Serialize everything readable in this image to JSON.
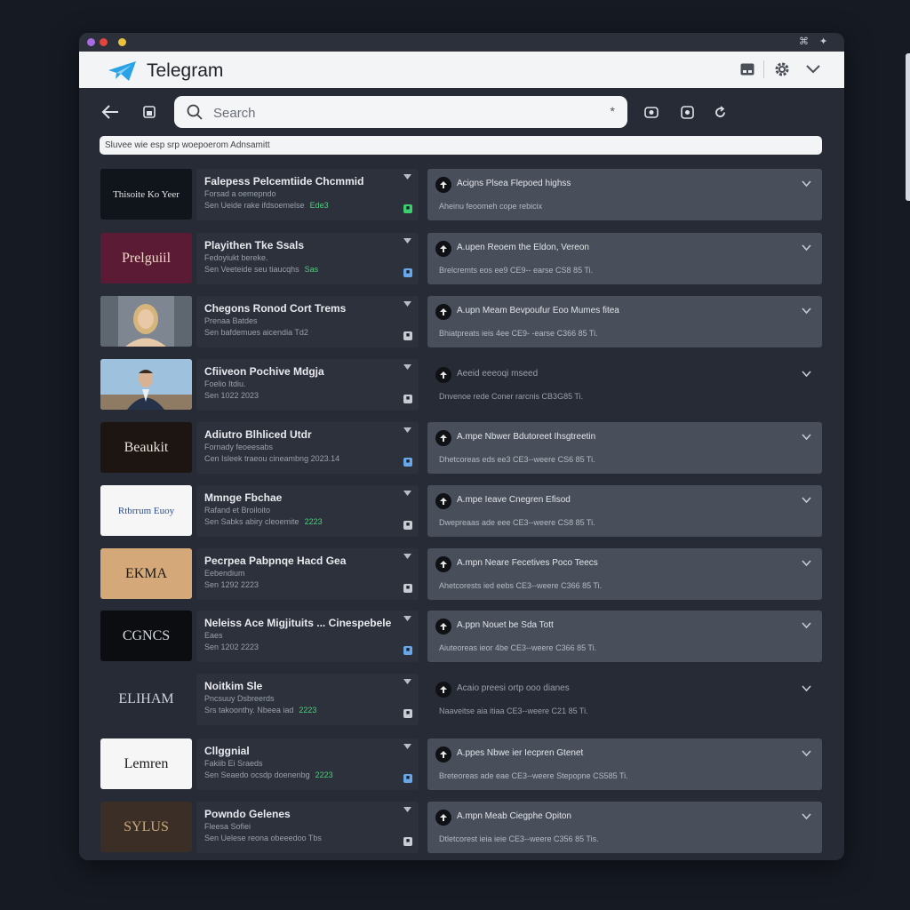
{
  "window": {
    "title_bar_icons": [
      "pin-icon",
      "expand-icon"
    ],
    "traffic_lights": [
      "#a86be0",
      "#e0453f",
      "#e8c23a"
    ]
  },
  "app": {
    "title": "Telegram",
    "accent": "#2aa3e6"
  },
  "toolbar": {
    "search_placeholder": "Search",
    "clear_symbol": "*"
  },
  "notice": "Sluvee wie esp srp woepoerom Adnsamitt",
  "rows": [
    {
      "thumb": {
        "text": "Thisoite Ko Yeer",
        "bg": "#10141b",
        "fg": "#e5e5e5"
      },
      "title": "Falepess Pelcemtiide Chcmmid",
      "subtitle": "Forsad a oemepndo",
      "meta": "Sen   Ueide rake ifdsoemelse",
      "tag": "Ede3",
      "badge_color": "#3ccf6e",
      "msg_head": "Acigns Plsea Flepoed highss",
      "msg_meta": "Aheinu feoomeh cope rebicix",
      "msg_style": "filled"
    },
    {
      "thumb": {
        "text": "Prelguiil",
        "bg": "#5b1b35",
        "fg": "#f0d7c7"
      },
      "title": "Playithen Tke Ssals",
      "subtitle": "Fedoyiukt bereke.",
      "meta": "Sen   Veeteide seu tiaucqhs",
      "tag": "Sas",
      "badge_color": "#6aa7e8",
      "msg_head": "A.upen Reoem the Eldon, Vereon",
      "msg_meta": "Brelcremts eos ee9   CE9-- earse   CS8 85 Ti.",
      "msg_style": "filled"
    },
    {
      "thumb": {
        "text": "",
        "bg": "#6b7580",
        "fg": "#ffffff",
        "photo": "woman"
      },
      "title": "Chegons Ronod Cort Trems",
      "subtitle": "Prenaa Batdes",
      "meta": "Sen   bafdemues aicendia Td2",
      "tag": "",
      "badge_color": "#c9ccd3",
      "msg_head": "A.upn Meam Bevpoufur Eoo Mumes fitea",
      "msg_meta": "Bhiatpreats ieis 4ee   CE9- -earse   C366 85 Ti.",
      "msg_style": "filled"
    },
    {
      "thumb": {
        "text": "",
        "bg": "#8fb6d4",
        "fg": "#ffffff",
        "photo": "man"
      },
      "title": "Cfiiveon Pochive Mdgja",
      "subtitle": "Foelio  Itdiu.",
      "meta": "Sen   1022 2023",
      "tag": "",
      "badge_color": "#c9ccd3",
      "msg_head": "Aeeid eeeoqi mseed",
      "msg_meta": "Dnvenoe rede Coner rarcnis CB3G85 Ti.",
      "msg_style": "plain"
    },
    {
      "thumb": {
        "text": "Beaukit",
        "bg": "#1c1512",
        "fg": "#e9e2da"
      },
      "title": "Adiutro Blhliced Utdr",
      "subtitle": "Fornady feoeesabs",
      "meta": "Cen   Isleek traeou cineambng   2023.14",
      "tag": "",
      "badge_color": "#6aa7e8",
      "msg_head": "A.mpe Nbwer Bdutoreet Ihsgtreetin",
      "msg_meta": "Dhetcoreas eds ee3   CE3--weere   CS6 85 Ti.",
      "msg_style": "filled"
    },
    {
      "thumb": {
        "text": "Rtbrrum Euoy",
        "bg": "#f6f6f6",
        "fg": "#2c4c8c"
      },
      "title": "Mmnge Fbchae",
      "subtitle": "Rafand et Broiloito",
      "meta": "Sen   Sabks abiry cleoemite",
      "tag": "2223",
      "badge_color": "#c9ccd3",
      "msg_head": "A.mpe Ieave Cnegren Efisod",
      "msg_meta": "Dwepreaas ade eee   CE3--weere   CS8 85 Ti.",
      "msg_style": "filled"
    },
    {
      "thumb": {
        "text": "EKMA",
        "bg": "#d4a878",
        "fg": "#1a1a1a"
      },
      "title": "Pecrpea Pabpnqe Hacd Gea",
      "subtitle": "Eebendium",
      "meta": "Sen   1292 2223",
      "tag": "",
      "badge_color": "#c9ccd3",
      "msg_head": "A.mpn Neare Fecetives Poco Teecs",
      "msg_meta": "Ahetcorests ied eebs   CE3--weere   C366 85 Ti.",
      "msg_style": "filled"
    },
    {
      "thumb": {
        "text": "CGNCS",
        "bg": "#0c0d10",
        "fg": "#d7dde6"
      },
      "title": "Neleiss Ace Migjituits ... Cinespebele",
      "subtitle": "Eaes",
      "meta": "Sen   1202 2223",
      "tag": "",
      "badge_color": "#6aa7e8",
      "msg_head": "A.ppn Nouet be Sda Tott",
      "msg_meta": "Aiuteoreas ieor 4be   CE3--weere   C366 85 Ti.",
      "msg_style": "filled"
    },
    {
      "thumb": {
        "text": "ELIHAM",
        "bg": "#262b35",
        "fg": "#cfd3da"
      },
      "title": "Noitkim Sle",
      "subtitle": "Pncsuuy Dsbreerds",
      "meta": "Srs   takoonthy. Nbeea iad",
      "tag": "2223",
      "badge_color": "#c9ccd3",
      "msg_head": "Acaio preesi ortp ooo dianes",
      "msg_meta": "Naaveitse aia itiaa   CE3--weere   C21 85 Ti.",
      "msg_style": "plain"
    },
    {
      "thumb": {
        "text": "Lemren",
        "bg": "#f6f6f6",
        "fg": "#1a1a1a"
      },
      "title": "Cllggnial",
      "subtitle": "Fakiib Ei Sraeds",
      "meta": "Sen   Seaedo ocsdp doenenbg",
      "tag": "2223",
      "badge_color": "#6aa7e8",
      "msg_head": "A.ppes Nbwe ier Iecpren Gtenet",
      "msg_meta": "Breteoreas ade eae   CE3--weere   Stepopne CS585 Ti.",
      "msg_style": "filled"
    },
    {
      "thumb": {
        "text": "SYLUS",
        "bg": "#3b2e26",
        "fg": "#c9aa7a"
      },
      "title": "Powndo Gelenes",
      "subtitle": "Fleesa Sofiei",
      "meta": "Sen   Uelese reona obeeedoo Tbs",
      "tag": "",
      "badge_color": "#c9ccd3",
      "msg_head": "A.mpn Meab Ciegphe Opiton",
      "msg_meta": "Dtletcorest ieia ieie   CE3--weere   C356 85 Tis.",
      "msg_style": "filled"
    }
  ]
}
